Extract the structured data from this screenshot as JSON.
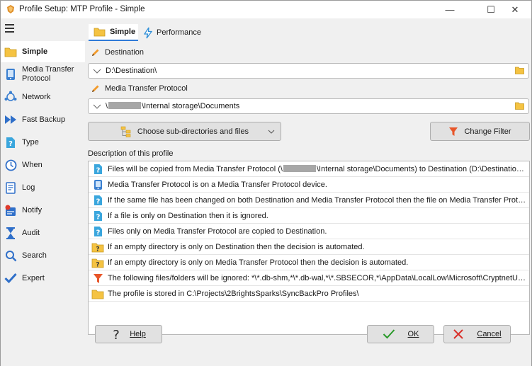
{
  "window": {
    "title": "Profile Setup: MTP Profile - Simple",
    "minimize_glyph": "—",
    "maximize_glyph": "☐",
    "close_glyph": "✕"
  },
  "sidebar": {
    "items": [
      {
        "id": "simple",
        "label": "Simple",
        "icon": "folder-icon",
        "active": true
      },
      {
        "id": "mtp",
        "label": "Media Transfer Protocol",
        "icon": "device-icon"
      },
      {
        "id": "network",
        "label": "Network",
        "icon": "network-icon"
      },
      {
        "id": "fastbackup",
        "label": "Fast Backup",
        "icon": "fast-forward-icon"
      },
      {
        "id": "type",
        "label": "Type",
        "icon": "question-file-icon"
      },
      {
        "id": "when",
        "label": "When",
        "icon": "clock-icon"
      },
      {
        "id": "log",
        "label": "Log",
        "icon": "log-icon"
      },
      {
        "id": "notify",
        "label": "Notify",
        "icon": "notify-icon"
      },
      {
        "id": "audit",
        "label": "Audit",
        "icon": "hourglass-icon"
      },
      {
        "id": "search",
        "label": "Search",
        "icon": "search-icon"
      },
      {
        "id": "expert",
        "label": "Expert",
        "icon": "check-icon"
      }
    ]
  },
  "tabs": [
    {
      "label": "Simple",
      "active": true
    },
    {
      "label": "Performance"
    }
  ],
  "destination": {
    "label": "Destination",
    "path": "D:\\Destination\\"
  },
  "source": {
    "label": "Media Transfer Protocol",
    "path_prefix": "\\",
    "path_suffix": "\\Internal storage\\Documents"
  },
  "buttons": {
    "subdirs": "Choose sub-directories and files",
    "change_filter": "Change Filter",
    "help": "Help",
    "ok": "OK",
    "cancel": "Cancel"
  },
  "description": {
    "label": "Description of this profile",
    "rows": [
      {
        "icon": "question-file-icon",
        "text_a": "Files will be copied from Media Transfer Protocol (\\",
        "redacted": true,
        "text_b": "\\Internal storage\\Documents) to Destination (D:\\Destination\\)."
      },
      {
        "icon": "device-icon",
        "text_a": "Media Transfer Protocol is on a Media Transfer Protocol device."
      },
      {
        "icon": "question-file-icon",
        "text_a": "If the same file has been changed on both Destination and Media Transfer Protocol then the file on Media Transfer Protocol will replace the file on Destination."
      },
      {
        "icon": "question-file-icon",
        "text_a": "If a file is only on Destination then it is ignored."
      },
      {
        "icon": "question-file-icon",
        "text_a": "Files only on Media Transfer Protocol are copied to Destination."
      },
      {
        "icon": "question-folder-icon",
        "text_a": "If an empty directory is only on Destination then the decision is automated."
      },
      {
        "icon": "question-folder-icon",
        "text_a": "If an empty directory is only on Media Transfer Protocol then the decision is automated."
      },
      {
        "icon": "filter-icon",
        "text_a": "The following files/folders will be ignored: *\\*.db-shm,*\\*.db-wal,*\\*.SBSECOR,*\\AppData\\LocalLow\\Microsoft\\CryptnetUrlCache\\,*\\AppData\\Local\\Temp\\"
      },
      {
        "icon": "folder-icon",
        "text_a": "The profile is stored in C:\\Projects\\2BrightsSparks\\SyncBackPro Profiles\\"
      }
    ]
  },
  "colors": {
    "accent": "#2f7bd8",
    "folder": "#f5c342",
    "question": "#3aa6dd",
    "filter": "#e8562a",
    "ok_check": "#2a9a2a",
    "cancel_x": "#d9302a"
  }
}
